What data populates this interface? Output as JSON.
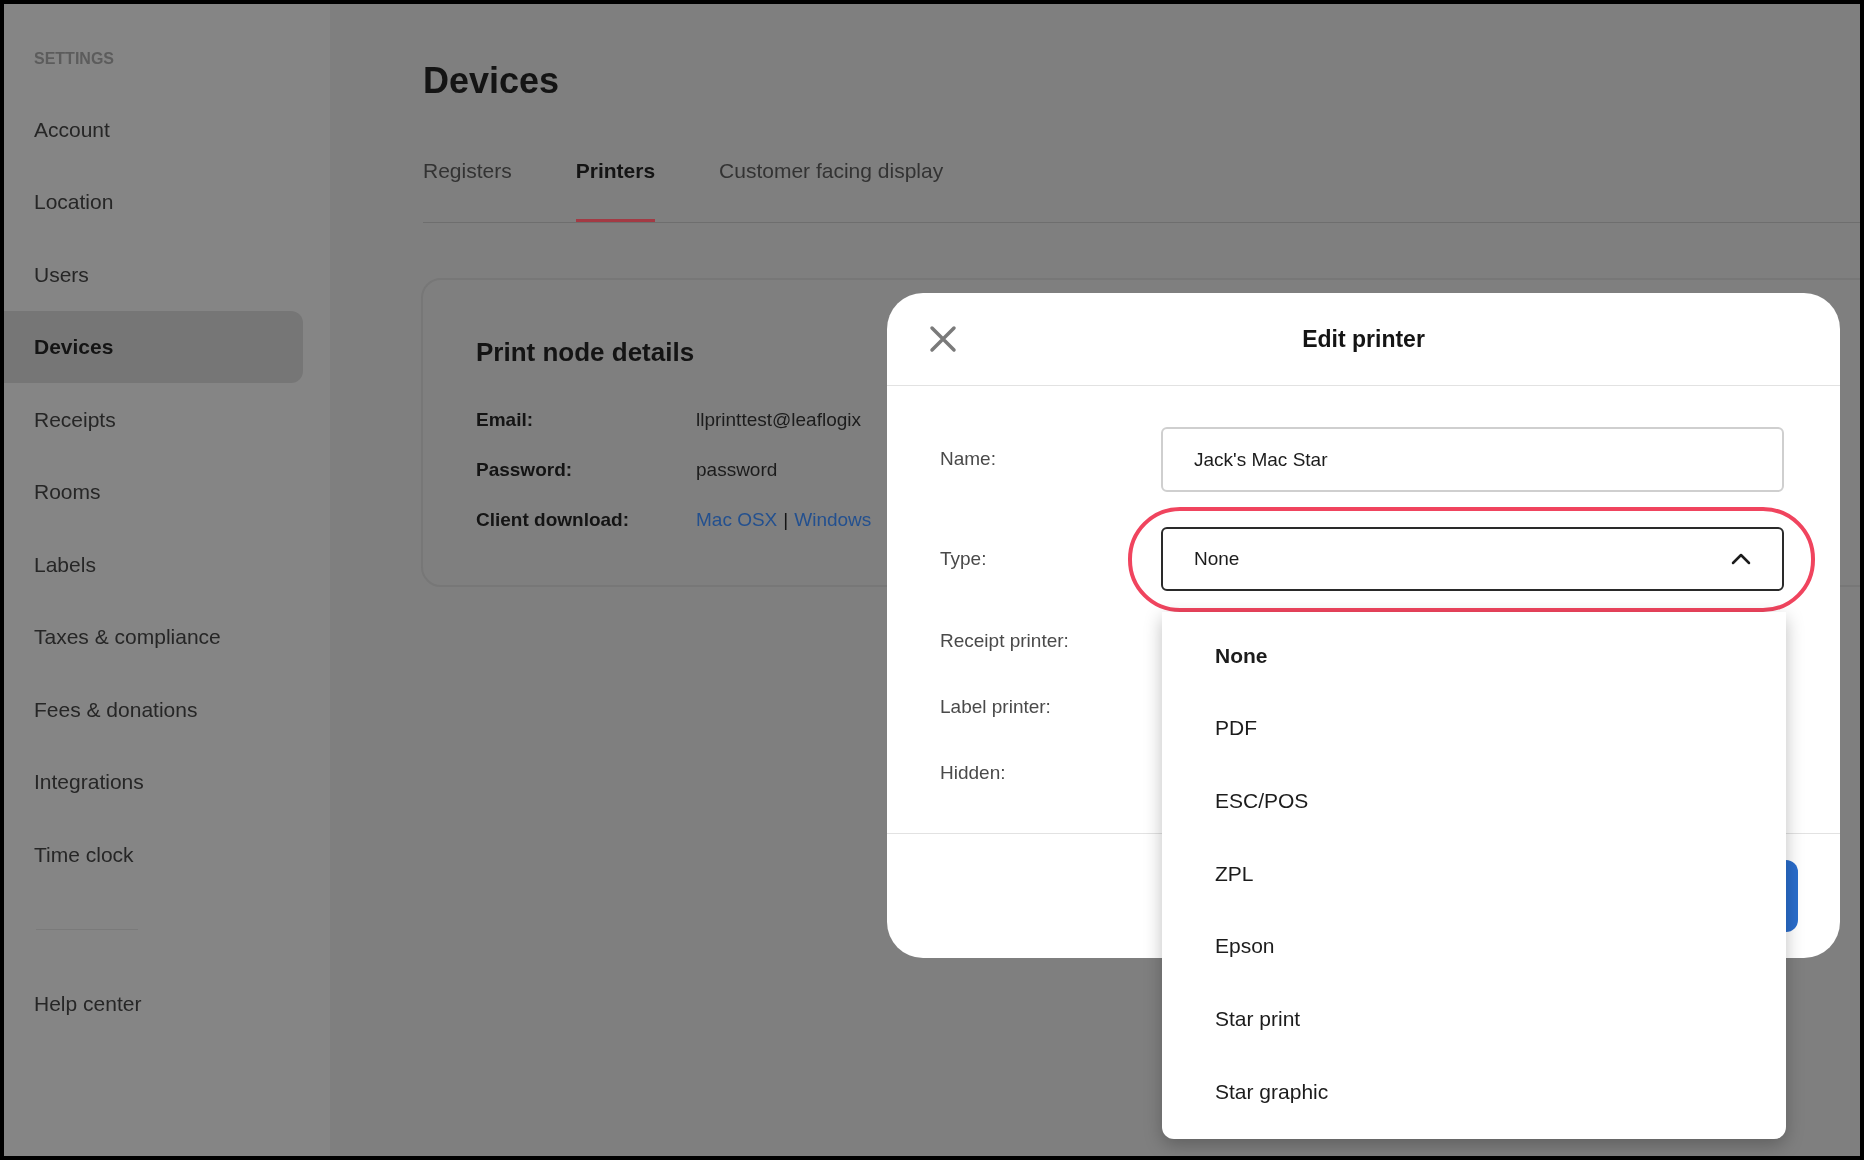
{
  "sidebar": {
    "heading": "SETTINGS",
    "items": [
      {
        "label": "Account",
        "selected": false
      },
      {
        "label": "Location",
        "selected": false
      },
      {
        "label": "Users",
        "selected": false
      },
      {
        "label": "Devices",
        "selected": true
      },
      {
        "label": "Receipts",
        "selected": false
      },
      {
        "label": "Rooms",
        "selected": false
      },
      {
        "label": "Labels",
        "selected": false
      },
      {
        "label": "Taxes & compliance",
        "selected": false
      },
      {
        "label": "Fees & donations",
        "selected": false
      },
      {
        "label": "Integrations",
        "selected": false
      },
      {
        "label": "Time clock",
        "selected": false
      }
    ],
    "footer_items": [
      {
        "label": "Help center",
        "selected": false
      }
    ]
  },
  "page": {
    "title": "Devices",
    "tabs": [
      {
        "label": "Registers",
        "selected": false
      },
      {
        "label": "Printers",
        "selected": true
      },
      {
        "label": "Customer facing display",
        "selected": false
      }
    ]
  },
  "card": {
    "title": "Print node details",
    "rows": [
      {
        "kind": "text",
        "label": "Email:",
        "value": "llprinttest@leaflogix"
      },
      {
        "kind": "text",
        "label": "Password:",
        "value": "password"
      },
      {
        "kind": "links",
        "label": "Client download:",
        "links": [
          "Mac OSX",
          "Windows"
        ],
        "separator": "|"
      }
    ]
  },
  "modal": {
    "title": "Edit printer",
    "fields": [
      {
        "kind": "input",
        "label": "Name:",
        "value": "Jack's Mac Star"
      },
      {
        "kind": "select",
        "label": "Type:",
        "value": "None",
        "expanded": true,
        "highlighted": true
      },
      {
        "kind": "covered",
        "label": "Receipt printer:"
      },
      {
        "kind": "covered",
        "label": "Label printer:"
      },
      {
        "kind": "covered",
        "label": "Hidden:"
      }
    ],
    "type_options": [
      {
        "label": "None",
        "selected": true
      },
      {
        "label": "PDF",
        "selected": false
      },
      {
        "label": "ESC/POS",
        "selected": false
      },
      {
        "label": "ZPL",
        "selected": false
      },
      {
        "label": "Epson",
        "selected": false
      },
      {
        "label": "Star print",
        "selected": false
      },
      {
        "label": "Star graphic",
        "selected": false
      }
    ]
  }
}
